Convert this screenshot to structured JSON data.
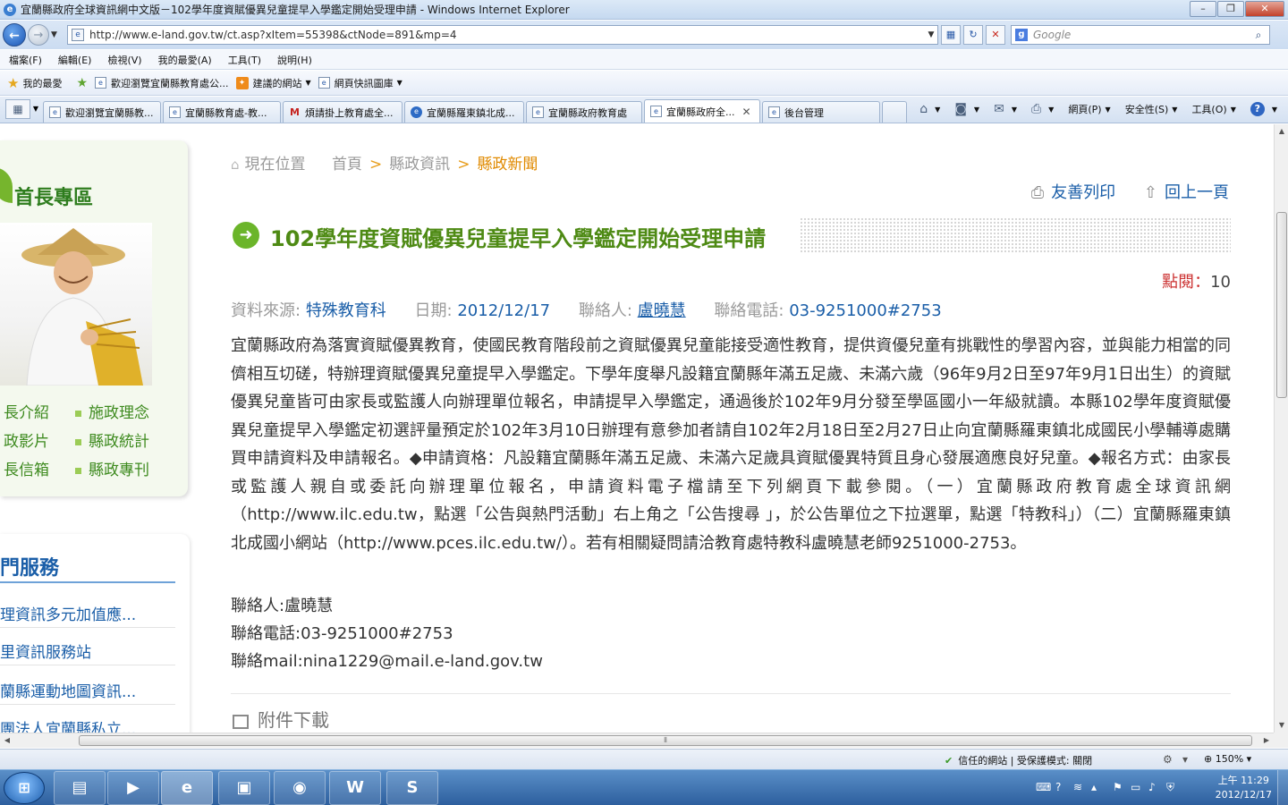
{
  "window": {
    "title": "宜蘭縣政府全球資訊網中文版－102學年度資賦優異兒童提早入學鑑定開始受理申請 - Windows Internet Explorer"
  },
  "address_bar": {
    "url": "http://www.e-land.gov.tw/ct.asp?xItem=55398&ctNode=891&mp=4",
    "search_placeholder": "Google"
  },
  "menu": [
    "檔案(F)",
    "編輯(E)",
    "檢視(V)",
    "我的最愛(A)",
    "工具(T)",
    "說明(H)"
  ],
  "favorites_bar": {
    "favorites_label": "我的最愛",
    "links": [
      "歡迎瀏覽宜蘭縣教育處公...",
      "建議的網站",
      "網頁快訊圖庫"
    ]
  },
  "tabs": [
    "歡迎瀏覽宜蘭縣教...",
    "宜蘭縣教育處-教...",
    "煩請掛上教育處全...",
    "宜蘭縣羅東鎮北成...",
    "宜蘭縣政府教育處",
    "宜蘭縣政府全...",
    "後台管理"
  ],
  "command_bar": {
    "page": "網頁(P)",
    "safety": "安全性(S)",
    "tools": "工具(O)"
  },
  "sidebar": {
    "title": "首長專區",
    "links": [
      "長介紹",
      "施政理念",
      "政影片",
      "縣政統計",
      "長信箱",
      "縣政專刊"
    ],
    "services_title": "門服務",
    "services": [
      "理資訊多元加值應...",
      "里資訊服務站",
      "蘭縣運動地圖資訊...",
      "團法人宜蘭縣私立..."
    ]
  },
  "breadcrumb": {
    "current_label": "現在位置",
    "home": "首頁",
    "level1": "縣政資訊",
    "level2": "縣政新聞"
  },
  "article_tools": {
    "print": "友善列印",
    "back": "回上一頁"
  },
  "article": {
    "title": "102學年度資賦優異兒童提早入學鑑定開始受理申請",
    "views_label": "點閱：",
    "views": "10",
    "source_label": "資料來源:",
    "source": "特殊教育科",
    "date_label": "日期:",
    "date": "2012/12/17",
    "contact_label": "聯絡人:",
    "contact": "盧曉慧",
    "phone_label": "聯絡電話:",
    "phone": "03-9251000#2753",
    "body": "宜蘭縣政府為落實資賦優異教育，使國民教育階段前之資賦優異兒童能接受適性教育，提供資優兒童有挑戰性的學習內容，並與能力相當的同儕相互切磋，特辦理資賦優異兒童提早入學鑑定。下學年度舉凡設籍宜蘭縣年滿五足歲、未滿六歲（96年9月2日至97年9月1日出生）的資賦優異兒童皆可由家長或監護人向辦理單位報名，申請提早入學鑑定，通過後於102年9月分發至學區國小一年級就讀。本縣102學年度資賦優異兒童提早入學鑑定初選評量預定於102年3月10日辦理有意參加者請自102年2月18日至2月27日止向宜蘭縣羅東鎮北成國民小學輔導處購買申請資料及申請報名。◆申請資格：凡設籍宜蘭縣年滿五足歲、未滿六足歲具資賦優異特質且身心發展適應良好兒童。◆報名方式：由家長或監護人親自或委託向辦理單位報名，申請資料電子檔請至下列網頁下載參閱。（一）宜蘭縣政府教育處全球資訊網（http://www.ilc.edu.tw，點選「公告與熱門活動」右上角之「公告搜尋 」，於公告單位之下拉選單，點選「特教科」）（二）宜蘭縣羅東鎮北成國小網站（http://www.pces.ilc.edu.tw/）。若有相關疑問請洽教育處特教科盧曉慧老師9251000-2753。",
    "contact_lines": [
      "聯絡人:盧曉慧",
      "聯絡電話:03-9251000#2753",
      "聯絡mail:nina1229@mail.e-land.gov.tw"
    ],
    "attachments_label": "附件下載"
  },
  "status_bar": {
    "zone": "信任的網站 | 受保護模式: 關閉",
    "zoom": "150%"
  },
  "taskbar": {
    "time": "上午 11:29",
    "date": "2012/12/17"
  },
  "colors": {
    "accent_green": "#4e8a14",
    "link_blue": "#1a5ea8",
    "breadcrumb_orange": "#e08a00"
  }
}
